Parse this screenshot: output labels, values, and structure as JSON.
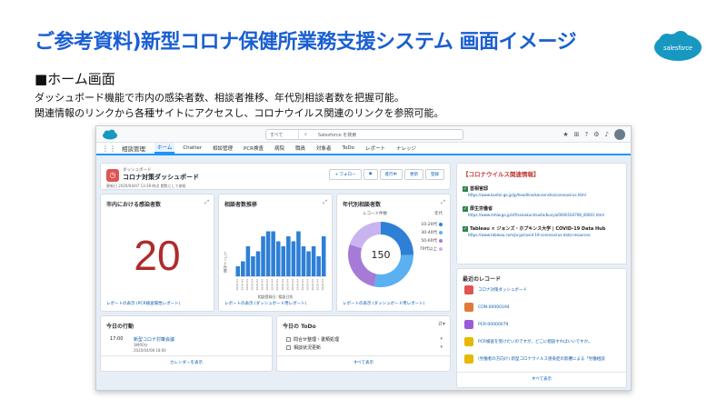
{
  "slide": {
    "title": "ご参考資料)新型コロナ保健所業務支援システム 画面イメージ",
    "subtitle": "■ホーム画面",
    "description_1": "ダッシュボード機能で市内の感染者数、相談者推移、年代別相談者数を把握可能。",
    "description_2": "関連情報のリンクから各種サイトにアクセスし、コロナウイルス関連のリンクを参照可能。",
    "logo_text": "salesforce"
  },
  "topbar": {
    "search_scope": "すべて",
    "search_placeholder": "Salesforce を検索"
  },
  "nav": {
    "app_name": "相談管理",
    "items": [
      "ホーム",
      "Chatter",
      "相談管理",
      "PCR検査",
      "病院",
      "職員",
      "対象者",
      "ToDo",
      "レポート",
      "ナレッジ"
    ]
  },
  "dashboard": {
    "kicker": "ダッシュボード",
    "name": "コロナ対策ダッシュボード",
    "meta": "更新日 2020/04/07 13:39 時点 閲覧として参照",
    "buttons": [
      "+ フォロー",
      "進行中",
      "更新",
      "登録"
    ]
  },
  "infection": {
    "title": "市内における感染者数",
    "value": "20",
    "footer": "レポートの表示 (PCR検査陽性レポート)"
  },
  "trend": {
    "title": "相談者数推移",
    "ylabel": "レコード件数",
    "xlabel": "相談登録日: 相談日別",
    "footer": "レポートの表示 (ダッシュボード用レポート)"
  },
  "age": {
    "title": "年代別相談者数",
    "center": "150",
    "legend_title": "年代",
    "subhead": "レコード件数",
    "footer": "レポートの表示 (ダッシュボード用レポート)"
  },
  "events": {
    "title": "今日の行動",
    "time": "17:00",
    "event_title": "新型コロナ対策会議",
    "event_sub1": "3時00分",
    "event_sub2": "2020/04/08 18:00",
    "link": "カレンダーを表示"
  },
  "todo": {
    "title": "今日の ToDo",
    "items": [
      "問合せ整理・書類処理",
      "相談状況更新"
    ],
    "link": "すべて表示"
  },
  "links": {
    "title": "【コロナウイルス関連情報】",
    "items": [
      {
        "name": "首相官邸",
        "url": "https://www.kantei.go.jp/jp/headline/kansensho/coronavirus.html"
      },
      {
        "name": "厚生労働省",
        "url": "https://www.mhlw.go.jp/stf/seisakunitsuite/bunya/0000164708_00001.html"
      },
      {
        "name": "Tableau × ジョンズ・ホプキンス大学 | COVID-19 Data Hub",
        "url": "https://www.tableau.com/ja-jp/covid-19-coronavirus-data-resources"
      }
    ]
  },
  "recent": {
    "title": "最近のレコード",
    "items": [
      "コロナ対策ダッシュボード",
      "CON-00000194",
      "PCR-00000079",
      "PCR検査を受けたいのですが、どこに相談すればいいですか。",
      "(労働者の方向け) 新型コロナウイルス感染症の影響による「労働相談"
    ],
    "link": "すべて表示"
  },
  "chart_data": [
    {
      "type": "bar",
      "title": "相談者数推移",
      "ylabel": "レコード件数",
      "xlabel": "相談登録日: 相談日別",
      "categories": [
        "d1",
        "d2",
        "d3",
        "d4",
        "d5",
        "d6",
        "d7",
        "d8",
        "d9",
        "d10",
        "d11",
        "d12",
        "d13",
        "d14",
        "d15",
        "d16",
        "d17",
        "d18"
      ],
      "values": [
        2,
        3,
        6,
        4,
        5,
        8,
        9,
        9,
        7,
        6,
        8,
        7,
        9,
        6,
        5,
        6,
        4,
        8
      ],
      "ylim": [
        0,
        10
      ]
    },
    {
      "type": "pie",
      "title": "年代別相談者数",
      "center_label": "150",
      "labels": [
        "10-20代",
        "30-40代",
        "50-60代",
        "70代以上"
      ],
      "values": [
        38,
        42,
        40,
        30
      ],
      "colors": [
        "#2e7fd6",
        "#5bb0f2",
        "#a67bd8",
        "#c9b4ef"
      ]
    }
  ]
}
